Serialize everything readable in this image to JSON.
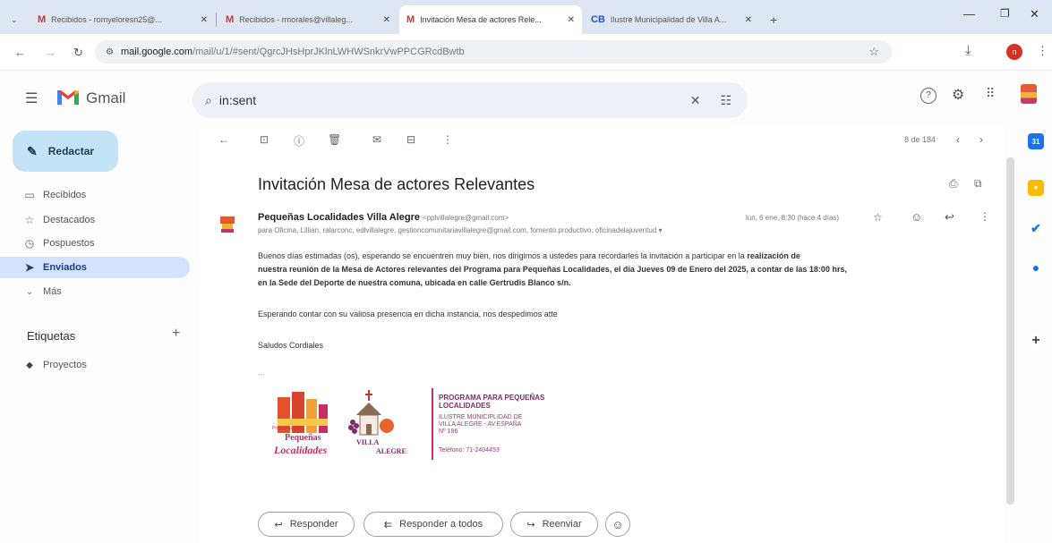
{
  "browser": {
    "tabs": [
      {
        "title": "Recibidos - romyeloresn25@...",
        "favicon": "M"
      },
      {
        "title": "Recibidos - rmorales@villaleg...",
        "favicon": "M"
      },
      {
        "title": "Invitación Mesa de actores Rele...",
        "favicon": "M"
      },
      {
        "title": "Ilustre Municipalidad de Villa A...",
        "favicon": "CB"
      }
    ],
    "url_host": "mail.google.com",
    "url_path": "/mail/u/1/#sent/QgrcJHsHprJKlnLWHWSnkrVwPPCGRcdBwtb"
  },
  "gmail": {
    "brand": "Gmail",
    "search_value": "in:sent"
  },
  "nav": {
    "compose": "Redactar",
    "items": [
      "Recibidos",
      "Destacados",
      "Pospuestos",
      "Enviados",
      "Más"
    ],
    "labels_heading": "Etiquetas",
    "labels": [
      "Proyectos"
    ]
  },
  "toolbar": {
    "pagination": "8 de 184"
  },
  "email": {
    "subject": "Invitación Mesa de actores Relevantes",
    "sender_name": "Pequeñas Localidades Villa Alegre",
    "sender_email": "<pplvillalegre@gmail.com>",
    "date": "lun, 6 ene, 8:30 (hace 4 días)",
    "recipients": "para Oficina, Lillian, ralarconc, edlvillalegre, gestioncomunitariavillalegre@gmail.com, fomento.productivo, oficinadelajuventud",
    "para1_line1": "Buenos días estimadas (os), esperando se encuentren muy bien, nos dirigimos a ustedes para recordarles la invitación a participar en la ",
    "para1_line1_bold": "realización de",
    "para1_line2": "nuestra reunión de la Mesa de Actores relevantes del Programa para Pequeñas Localidades, el día Jueves 09 de Enero del 2025, a contar de las 18:00 hrs,",
    "para1_line3": "en la Sede del Deporte de nuestra comuna, ubicada en calle Gertrudis Blanco s/n.",
    "para2": "Esperando contar con su valiosa presencia en dicha instancia,  nos despedimos atte",
    "closing": "Saludos Cordiales",
    "ellipsis": "...",
    "signature": {
      "logo_small_text": "Programa para",
      "logo_word1": "Pequeñas",
      "logo_word2": "Localidades",
      "villa_text": "VILLA",
      "alegre_text": "ALEGRE",
      "program_line1": "PROGRAMA PARA PEQUEÑAS",
      "program_line2": "LOCALIDADES",
      "muni_line1": "ILUSTRE MUNICIPLIDAD DE",
      "muni_line2": "VILLA ALEGRE - AV.ESPAÑA",
      "muni_line3": "Nº 186",
      "phone": "Teléfono: 71-2404453"
    }
  },
  "actions": {
    "reply": "Responder",
    "reply_all": "Responder a todos",
    "forward": "Reenviar"
  }
}
